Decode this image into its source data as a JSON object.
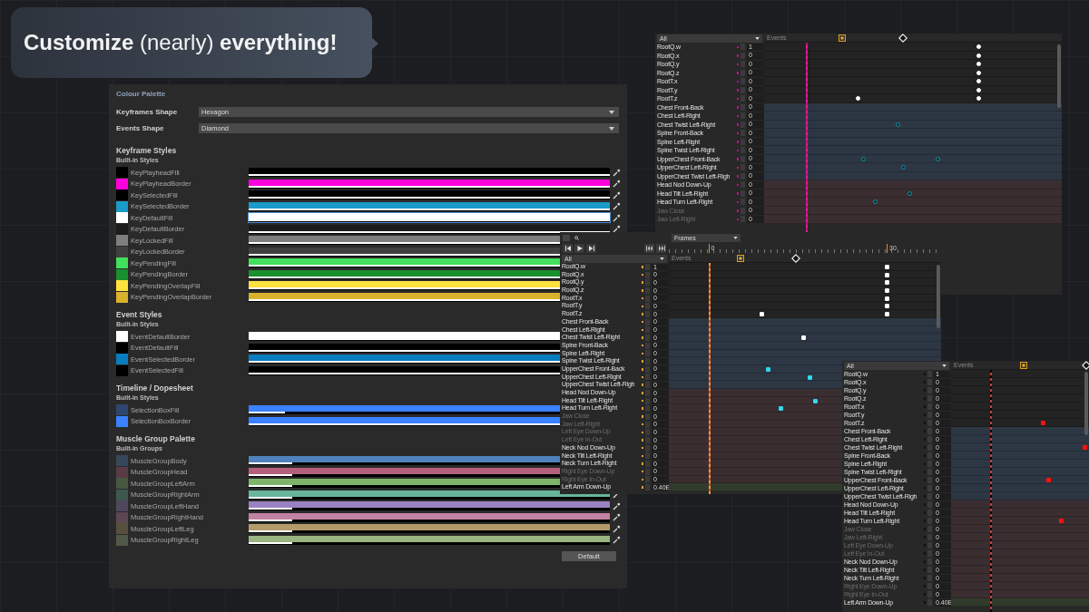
{
  "headline": "**Customize** (nearly) **everything!**",
  "palette": {
    "title": "Colour Palette",
    "fields": [
      {
        "label": "Keyframes Shape",
        "value": "Hexagon"
      },
      {
        "label": "Events Shape",
        "value": "Diamond"
      }
    ],
    "sections": [
      {
        "title": "Keyframe Styles",
        "subtitle": "Built-in Styles",
        "styles": [
          {
            "name": "KeyPlayheadFill",
            "color": "#000000",
            "level": 1,
            "selected": false
          },
          {
            "name": "KeyPlayheadBorder",
            "color": "#ff00dc",
            "level": 1,
            "selected": false
          },
          {
            "name": "KeySelectedFill",
            "color": "#000000",
            "level": 1,
            "selected": false
          },
          {
            "name": "KeySelectedBorder",
            "color": "#1b9bc8",
            "level": 1,
            "selected": false
          },
          {
            "name": "KeyDefaultFill",
            "color": "#ffffff",
            "level": 1,
            "selected": true
          },
          {
            "name": "KeyDefaultBorder",
            "color": "#1c1c1c",
            "level": 1,
            "selected": false
          },
          {
            "name": "KeyLockedFill",
            "color": "#7e7e7e",
            "level": 1,
            "selected": false
          },
          {
            "name": "KeyLockedBorder",
            "color": "#404040",
            "level": 1,
            "selected": false
          },
          {
            "name": "KeyPendingFill",
            "color": "#42e05c",
            "level": 1,
            "selected": false
          },
          {
            "name": "KeyPendingBorder",
            "color": "#1a8f2e",
            "level": 1,
            "selected": false
          },
          {
            "name": "KeyPendingOverlapFill",
            "color": "#ffe23e",
            "level": 1,
            "selected": false
          },
          {
            "name": "KeyPendingOverlapBorder",
            "color": "#d8b22c",
            "level": 1,
            "selected": false
          }
        ]
      },
      {
        "title": "Event Styles",
        "subtitle": "Built-in Styles",
        "styles": [
          {
            "name": "EventDefaultBorder",
            "color": "#ffffff",
            "level": 1,
            "selected": false
          },
          {
            "name": "EventDefaultFill",
            "color": "#000000",
            "level": 1,
            "selected": false
          },
          {
            "name": "EventSelectedBorder",
            "color": "#0a7cc0",
            "level": 1,
            "selected": false
          },
          {
            "name": "EventSelectedFill",
            "color": "#000000",
            "level": 1,
            "selected": false
          }
        ]
      },
      {
        "title": "Timeline / Dopesheet",
        "subtitle": "Built-in Styles",
        "styles": [
          {
            "name": "SelectionBoxFill",
            "color": "#3a82ff",
            "level": 0.1,
            "selected": false
          },
          {
            "name": "SelectionBoxBorder",
            "color": "#3a82ff",
            "level": 1,
            "selected": false
          }
        ]
      },
      {
        "title": "Muscle Group Palette",
        "subtitle": "Built-in Groups",
        "styles": [
          {
            "name": "MuscleGroupBody",
            "color": "#4f82bc",
            "level": 0.12,
            "selected": false
          },
          {
            "name": "MuscleGroupHead",
            "color": "#b4607a",
            "level": 0.12,
            "selected": false
          },
          {
            "name": "MuscleGroupLeftArm",
            "color": "#7db46a",
            "level": 0.12,
            "selected": false
          },
          {
            "name": "MuscleGroupRightArm",
            "color": "#68b49c",
            "level": 0.12,
            "selected": false
          },
          {
            "name": "MuscleGroupLeftHand",
            "color": "#9a82c2",
            "level": 0.12,
            "selected": false
          },
          {
            "name": "MuscleGroupRightHand",
            "color": "#c282a2",
            "level": 0.12,
            "selected": false
          },
          {
            "name": "MuscleGroupLeftLeg",
            "color": "#b49c6a",
            "level": 0.12,
            "selected": false
          },
          {
            "name": "MuscleGroupRightLeg",
            "color": "#9ab482",
            "level": 0.12,
            "selected": false
          }
        ]
      }
    ],
    "default_button": "Default"
  },
  "timelines": [
    {
      "kind": "magenta",
      "filter": "All",
      "events_label": "Events",
      "rows": [
        {
          "name": "RootQ.w",
          "value": "1",
          "dimmed": false,
          "kind": "root"
        },
        {
          "name": "RootQ.x",
          "value": "0",
          "dimmed": false,
          "kind": "root"
        },
        {
          "name": "RootQ.y",
          "value": "0",
          "dimmed": false,
          "kind": "root"
        },
        {
          "name": "RootQ.z",
          "value": "0",
          "dimmed": false,
          "kind": "root"
        },
        {
          "name": "RootT.x",
          "value": "0",
          "dimmed": false,
          "kind": "root"
        },
        {
          "name": "RootT.y",
          "value": "0",
          "dimmed": false,
          "kind": "root"
        },
        {
          "name": "RootT.z",
          "value": "0",
          "dimmed": false,
          "kind": "root"
        },
        {
          "name": "Chest Front-Back",
          "value": "0",
          "dimmed": false,
          "kind": "body"
        },
        {
          "name": "Chest Left-Right",
          "value": "0",
          "dimmed": false,
          "kind": "body"
        },
        {
          "name": "Chest Twist Left-Right",
          "value": "0",
          "dimmed": false,
          "kind": "body"
        },
        {
          "name": "Spine Front-Back",
          "value": "0",
          "dimmed": false,
          "kind": "body"
        },
        {
          "name": "Spine Left-Right",
          "value": "0",
          "dimmed": false,
          "kind": "body"
        },
        {
          "name": "Spine Twist Left-Right",
          "value": "0",
          "dimmed": false,
          "kind": "body"
        },
        {
          "name": "UpperChest Front-Back",
          "value": "0",
          "dimmed": false,
          "kind": "body"
        },
        {
          "name": "UpperChest Left-Right",
          "value": "0",
          "dimmed": false,
          "kind": "body"
        },
        {
          "name": "UpperChest Twist Left-Righ",
          "value": "0",
          "dimmed": false,
          "kind": "body"
        },
        {
          "name": "Head Nod Down-Up",
          "value": "0",
          "dimmed": false,
          "kind": "head"
        },
        {
          "name": "Head Tilt Left-Right",
          "value": "0",
          "dimmed": false,
          "kind": "head"
        },
        {
          "name": "Head Turn Left-Right",
          "value": "0",
          "dimmed": false,
          "kind": "head"
        },
        {
          "name": "Jaw Close",
          "value": "0",
          "dimmed": true,
          "kind": "head"
        },
        {
          "name": "Jaw Left-Right",
          "value": "0",
          "dimmed": true,
          "kind": "head"
        }
      ]
    },
    {
      "kind": "orange",
      "filter": "All",
      "events_label": "Events",
      "toolbar": {
        "mode": "Frames",
        "ruler": [
          "0",
          "30"
        ]
      },
      "rows": [
        {
          "name": "RootQ.w",
          "value": "1",
          "dimmed": false,
          "kind": "root"
        },
        {
          "name": "RootQ.x",
          "value": "0",
          "dimmed": false,
          "kind": "root"
        },
        {
          "name": "RootQ.y",
          "value": "0",
          "dimmed": false,
          "kind": "root"
        },
        {
          "name": "RootQ.z",
          "value": "0",
          "dimmed": false,
          "kind": "root"
        },
        {
          "name": "RootT.x",
          "value": "0",
          "dimmed": false,
          "kind": "root"
        },
        {
          "name": "RootT.y",
          "value": "0",
          "dimmed": false,
          "kind": "root"
        },
        {
          "name": "RootT.z",
          "value": "0",
          "dimmed": false,
          "kind": "root"
        },
        {
          "name": "Chest Front-Back",
          "value": "0",
          "dimmed": false,
          "kind": "body"
        },
        {
          "name": "Chest Left-Right",
          "value": "0",
          "dimmed": false,
          "kind": "body"
        },
        {
          "name": "Chest Twist Left-Right",
          "value": "0",
          "dimmed": false,
          "kind": "body"
        },
        {
          "name": "Spine Front-Back",
          "value": "0",
          "dimmed": false,
          "kind": "body"
        },
        {
          "name": "Spine Left-Right",
          "value": "0",
          "dimmed": false,
          "kind": "body"
        },
        {
          "name": "Spine Twist Left-Right",
          "value": "0",
          "dimmed": false,
          "kind": "body"
        },
        {
          "name": "UpperChest Front-Back",
          "value": "0",
          "dimmed": false,
          "kind": "body"
        },
        {
          "name": "UpperChest Left-Right",
          "value": "0",
          "dimmed": false,
          "kind": "body"
        },
        {
          "name": "UpperChest Twist Left-Righ",
          "value": "0",
          "dimmed": false,
          "kind": "body"
        },
        {
          "name": "Head Nod Down-Up",
          "value": "0",
          "dimmed": false,
          "kind": "head"
        },
        {
          "name": "Head Tilt Left-Right",
          "value": "0",
          "dimmed": false,
          "kind": "head"
        },
        {
          "name": "Head Turn Left-Right",
          "value": "0",
          "dimmed": false,
          "kind": "head"
        },
        {
          "name": "Jaw Close",
          "value": "0",
          "dimmed": true,
          "kind": "head"
        },
        {
          "name": "Jaw Left-Right",
          "value": "0",
          "dimmed": true,
          "kind": "head"
        },
        {
          "name": "Left Eye Down-Up",
          "value": "0",
          "dimmed": true,
          "kind": "head"
        },
        {
          "name": "Left Eye In-Out",
          "value": "0",
          "dimmed": true,
          "kind": "head"
        },
        {
          "name": "Neck Nod Down-Up",
          "value": "0",
          "dimmed": false,
          "kind": "head"
        },
        {
          "name": "Neck Tilt Left-Right",
          "value": "0",
          "dimmed": false,
          "kind": "head"
        },
        {
          "name": "Neck Turn Left-Right",
          "value": "0",
          "dimmed": false,
          "kind": "head"
        },
        {
          "name": "Right Eye Down-Up",
          "value": "0",
          "dimmed": true,
          "kind": "head"
        },
        {
          "name": "Right Eye In-Out",
          "value": "0",
          "dimmed": true,
          "kind": "head"
        },
        {
          "name": "Left Arm Down-Up",
          "value": "0.40E",
          "dimmed": false,
          "kind": "arm"
        }
      ]
    },
    {
      "kind": "red",
      "filter": "All",
      "events_label": "Events",
      "rows": [
        {
          "name": "RootQ.w",
          "value": "1",
          "dimmed": false,
          "kind": "root"
        },
        {
          "name": "RootQ.x",
          "value": "0",
          "dimmed": false,
          "kind": "root"
        },
        {
          "name": "RootQ.y",
          "value": "0",
          "dimmed": false,
          "kind": "root"
        },
        {
          "name": "RootQ.z",
          "value": "0",
          "dimmed": false,
          "kind": "root"
        },
        {
          "name": "RootT.x",
          "value": "0",
          "dimmed": false,
          "kind": "root"
        },
        {
          "name": "RootT.y",
          "value": "0",
          "dimmed": false,
          "kind": "root"
        },
        {
          "name": "RootT.z",
          "value": "0",
          "dimmed": false,
          "kind": "root"
        },
        {
          "name": "Chest Front-Back",
          "value": "0",
          "dimmed": false,
          "kind": "body"
        },
        {
          "name": "Chest Left-Right",
          "value": "0",
          "dimmed": false,
          "kind": "body"
        },
        {
          "name": "Chest Twist Left-Right",
          "value": "0",
          "dimmed": false,
          "kind": "body"
        },
        {
          "name": "Spine Front-Back",
          "value": "0",
          "dimmed": false,
          "kind": "body"
        },
        {
          "name": "Spine Left-Right",
          "value": "0",
          "dimmed": false,
          "kind": "body"
        },
        {
          "name": "Spine Twist Left-Right",
          "value": "0",
          "dimmed": false,
          "kind": "body"
        },
        {
          "name": "UpperChest Front-Back",
          "value": "0",
          "dimmed": false,
          "kind": "body"
        },
        {
          "name": "UpperChest Left-Right",
          "value": "0",
          "dimmed": false,
          "kind": "body"
        },
        {
          "name": "UpperChest Twist Left-Righ",
          "value": "0",
          "dimmed": false,
          "kind": "body"
        },
        {
          "name": "Head Nod Down-Up",
          "value": "0",
          "dimmed": false,
          "kind": "head"
        },
        {
          "name": "Head Tilt Left-Right",
          "value": "0",
          "dimmed": false,
          "kind": "head"
        },
        {
          "name": "Head Turn Left-Right",
          "value": "0",
          "dimmed": false,
          "kind": "head"
        },
        {
          "name": "Jaw Close",
          "value": "0",
          "dimmed": true,
          "kind": "head"
        },
        {
          "name": "Jaw Left-Right",
          "value": "0",
          "dimmed": true,
          "kind": "head"
        },
        {
          "name": "Left Eye Down-Up",
          "value": "0",
          "dimmed": true,
          "kind": "head"
        },
        {
          "name": "Left Eye In-Out",
          "value": "0",
          "dimmed": true,
          "kind": "head"
        },
        {
          "name": "Neck Nod Down-Up",
          "value": "0",
          "dimmed": false,
          "kind": "head"
        },
        {
          "name": "Neck Tilt Left-Right",
          "value": "0",
          "dimmed": false,
          "kind": "head"
        },
        {
          "name": "Neck Turn Left-Right",
          "value": "0",
          "dimmed": false,
          "kind": "head"
        },
        {
          "name": "Right Eye Down-Up",
          "value": "0",
          "dimmed": true,
          "kind": "head"
        },
        {
          "name": "Right Eye In-Out",
          "value": "0",
          "dimmed": true,
          "kind": "head"
        },
        {
          "name": "Left Arm Down-Up",
          "value": "0.40E",
          "dimmed": false,
          "kind": "arm"
        }
      ]
    }
  ]
}
